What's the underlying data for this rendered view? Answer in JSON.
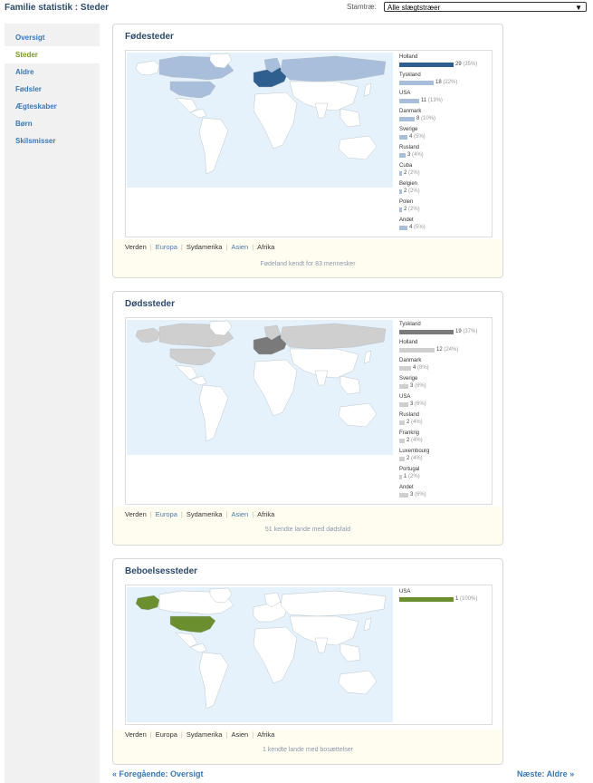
{
  "header": {
    "title": "Familie statistik : Steder",
    "tree_label": "Stamtræ:",
    "tree_value": "Alle slægtstræer"
  },
  "sidebar": {
    "items": [
      {
        "label": "Oversigt"
      },
      {
        "label": "Steder"
      },
      {
        "label": "Aldre"
      },
      {
        "label": "Fødsler"
      },
      {
        "label": "Ægteskaber"
      },
      {
        "label": "Børn"
      },
      {
        "label": "Skilsmisser"
      }
    ]
  },
  "regions": {
    "world": "Verden",
    "europe": "Europa",
    "south_america": "Sydamerika",
    "asia": "Asien",
    "africa": "Afrika"
  },
  "panels": {
    "birth": {
      "title": "Fødesteder",
      "footnote": "Fødeland kendt for 83 mennesker",
      "color_main": "#2f5f8f",
      "color_light": "#a8bedb",
      "bars": [
        {
          "label": "Holland",
          "count": "29",
          "pct": "(35%)",
          "value": 35
        },
        {
          "label": "Tyskland",
          "count": "18",
          "pct": "(22%)",
          "value": 22
        },
        {
          "label": "USA",
          "count": "11",
          "pct": "(13%)",
          "value": 13
        },
        {
          "label": "Danmark",
          "count": "8",
          "pct": "(10%)",
          "value": 10
        },
        {
          "label": "Sverige",
          "count": "4",
          "pct": "(5%)",
          "value": 5
        },
        {
          "label": "Rusland",
          "count": "3",
          "pct": "(4%)",
          "value": 4
        },
        {
          "label": "Cuba",
          "count": "2",
          "pct": "(2%)",
          "value": 2
        },
        {
          "label": "Belgien",
          "count": "2",
          "pct": "(2%)",
          "value": 2
        },
        {
          "label": "Polen",
          "count": "2",
          "pct": "(2%)",
          "value": 2
        },
        {
          "label": "Andet",
          "count": "4",
          "pct": "(5%)",
          "value": 5
        }
      ]
    },
    "death": {
      "title": "Dødssteder",
      "footnote": "51 kendte lande med dødsfald",
      "color_main": "#7a7a7a",
      "color_light": "#cfcfcf",
      "bars": [
        {
          "label": "Tyskland",
          "count": "19",
          "pct": "(37%)",
          "value": 37
        },
        {
          "label": "Holland",
          "count": "12",
          "pct": "(24%)",
          "value": 24
        },
        {
          "label": "Danmark",
          "count": "4",
          "pct": "(8%)",
          "value": 8
        },
        {
          "label": "Sverige",
          "count": "3",
          "pct": "(6%)",
          "value": 6
        },
        {
          "label": "USA",
          "count": "3",
          "pct": "(6%)",
          "value": 6
        },
        {
          "label": "Rusland",
          "count": "2",
          "pct": "(4%)",
          "value": 4
        },
        {
          "label": "Frankrig",
          "count": "2",
          "pct": "(4%)",
          "value": 4
        },
        {
          "label": "Luxembourg",
          "count": "2",
          "pct": "(4%)",
          "value": 4
        },
        {
          "label": "Portugal",
          "count": "1",
          "pct": "(2%)",
          "value": 2
        },
        {
          "label": "Andet",
          "count": "3",
          "pct": "(6%)",
          "value": 6
        }
      ]
    },
    "residence": {
      "title": "Beboelsessteder",
      "footnote": "1 kendte lande med bosættelser",
      "color_main": "#6b8e2f",
      "color_light": "#6b8e2f",
      "bars": [
        {
          "label": "USA",
          "count": "1",
          "pct": "(100%)",
          "value": 100
        }
      ]
    }
  },
  "pager": {
    "prev": "Foregående: Oversigt",
    "next": "Næste: Aldre"
  }
}
